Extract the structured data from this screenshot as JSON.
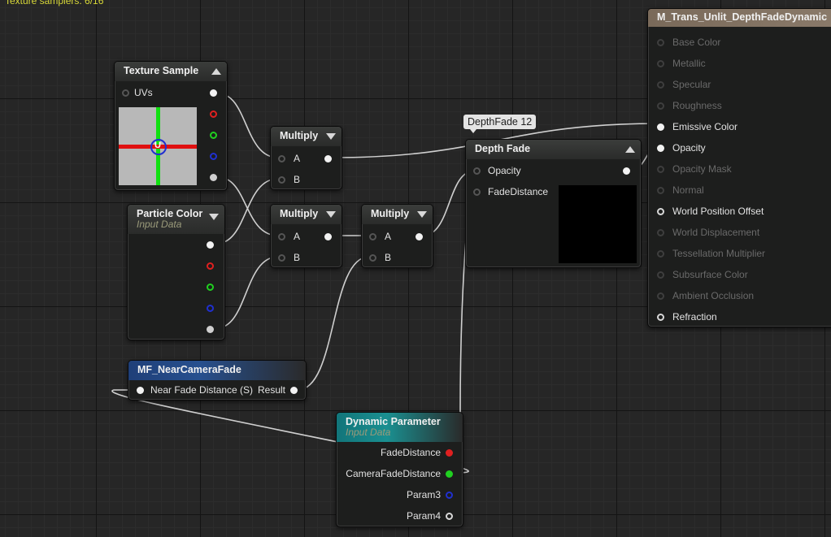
{
  "status_text": "Texture samplers: 6/16",
  "comment": "DepthFade 12",
  "nodes": {
    "texture_sample": {
      "title": "Texture Sample",
      "inputs": [
        "UVs"
      ]
    },
    "particle_color": {
      "title": "Particle Color",
      "subtitle": "Input Data"
    },
    "multiply_1": {
      "title": "Multiply",
      "inputs": [
        "A",
        "B"
      ]
    },
    "multiply_2": {
      "title": "Multiply",
      "inputs": [
        "A",
        "B"
      ]
    },
    "multiply_3": {
      "title": "Multiply",
      "inputs": [
        "A",
        "B"
      ]
    },
    "depth_fade": {
      "title": "Depth Fade",
      "inputs": [
        "Opacity",
        "FadeDistance"
      ]
    },
    "mf_near_camera_fade": {
      "title": "MF_NearCameraFade",
      "input": "Near Fade Distance (S)",
      "output": "Result"
    },
    "dynamic_parameter": {
      "title": "Dynamic Parameter",
      "subtitle": "Input Data",
      "outputs": [
        "FadeDistance",
        "CameraFadeDistance",
        "Param3",
        "Param4"
      ]
    },
    "material_result": {
      "title": "M_Trans_Unlit_DepthFadeDynamic",
      "inputs": [
        {
          "label": "Base Color",
          "active": false
        },
        {
          "label": "Metallic",
          "active": false
        },
        {
          "label": "Specular",
          "active": false
        },
        {
          "label": "Roughness",
          "active": false
        },
        {
          "label": "Emissive Color",
          "active": true,
          "connected": true
        },
        {
          "label": "Opacity",
          "active": true,
          "connected": true
        },
        {
          "label": "Opacity Mask",
          "active": false
        },
        {
          "label": "Normal",
          "active": false
        },
        {
          "label": "World Position Offset",
          "active": true,
          "connected": false
        },
        {
          "label": "World Displacement",
          "active": false
        },
        {
          "label": "Tessellation Multiplier",
          "active": false
        },
        {
          "label": "Subsurface Color",
          "active": false
        },
        {
          "label": "Ambient Occlusion",
          "active": false
        },
        {
          "label": "Refraction",
          "active": true,
          "connected": false
        }
      ]
    }
  },
  "colors": {
    "canvas": "#262626",
    "wire": "#cfcfcf",
    "red_channel": "#e02020",
    "green_channel": "#20d020",
    "blue_channel": "#2030d0",
    "function_header": "#27508f",
    "dynamic_header": "#1a8f90",
    "result_header": "#8a7a6a"
  },
  "icons": [
    "collapse-arrow-icon",
    "pin-icon",
    "texture-preview-icon"
  ]
}
